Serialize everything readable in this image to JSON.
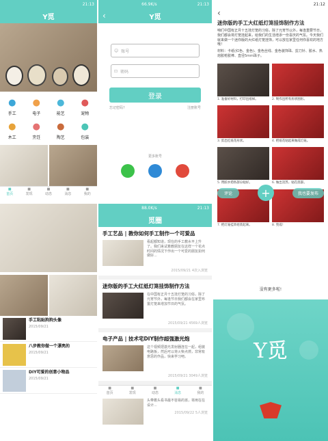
{
  "status": {
    "carrier": "",
    "time1": "21:13",
    "time2": "21:13",
    "time3": "21:12",
    "time4": "21:13",
    "speed1": "",
    "speed2": "66.9K/s",
    "speed3": "88.0K/s"
  },
  "app": {
    "title": "Y觅"
  },
  "home": {
    "grid": [
      {
        "label": "手工",
        "icon": "scissors-icon",
        "color": "#3da7d8"
      },
      {
        "label": "电子",
        "icon": "bulb-icon",
        "color": "#f0a14a"
      },
      {
        "label": "能艺",
        "icon": "paper-plane-icon",
        "color": "#4cb7d9"
      },
      {
        "label": "宠物",
        "icon": "paw-icon",
        "color": "#e05a5a"
      },
      {
        "label": "木工",
        "icon": "hammer-icon",
        "color": "#e7a33a"
      },
      {
        "label": "烹饪",
        "icon": "pot-icon",
        "color": "#e57373"
      },
      {
        "label": "陶艺",
        "icon": "vase-icon",
        "color": "#c96b3c"
      },
      {
        "label": "包装",
        "icon": "gift-icon",
        "color": "#4cc5b6"
      }
    ],
    "nav": [
      "首页",
      "发现",
      "动态",
      "消息",
      "我的"
    ]
  },
  "login": {
    "back": "‹",
    "title": "Y觅",
    "phone_placeholder": "账号",
    "password_placeholder": "密码",
    "login_button": "登录",
    "forgot": "忘记密码?",
    "register": "注册账号",
    "more": "更多账号",
    "social": [
      {
        "name": "wechat-icon",
        "color": "#3cc24a"
      },
      {
        "name": "qq-icon",
        "color": "#2f8ad6"
      },
      {
        "name": "weibo-icon",
        "color": "#e14a3c"
      }
    ]
  },
  "circle": {
    "title": "觅圈",
    "articles": [
      {
        "title": "手工艺品 | 教你如何手工制作一个可爱品",
        "text": "看起都知道，现在的手工教水平上升了。我们来试着教朋友在这样一个花点时间的情况下作出一个可爱的朋友如何做好...",
        "meta": "2015/09/21 4次入浏览"
      },
      {
        "title": "迷你版的手工大红纸灯笼挂饰制作方法",
        "text": "在中国有正月十五挂灯笼的习俗，除了元宵节外，每逢节日我们都会在家里布置灯笼来增加节日的气氛。",
        "meta": "2015/09/21 4569人浏览"
      },
      {
        "title": "电子产品 | 技术宅DIY制作超强激光炮",
        "text": "这个视频把激光发射器连在一起，组装电路板，然后可以将火柴点燃，非常有意思的作品，快来学习吧。",
        "meta": "2015/09/21 3049人浏览"
      }
    ],
    "extra": "头带着头看书最不容易的孩，将用在在设计...",
    "extra_meta": "2015/09/22 5人浏览",
    "nav": [
      "首页",
      "发现",
      "动态",
      "消息",
      "我的"
    ]
  },
  "detail": {
    "title": "迷你版的手工大红纸灯笼挂饰制作方法",
    "intro": "咱们中国有正月十五挂灯笼的习俗，除了元宵节以外，每逢重要节日，我们都会将灯笼挂起来，给我们的生活增添一份喜庆的气氛。今天我们就来做一个迷你版的大红纸灯笼挂饰，可以放在家里任何你喜欢的地方哦！",
    "materials": "材料：卡纸(红色、金色)、金色丝线、金色装饰珠、剪刀针、胶水、热熔胶枪胶棒、直径5mm珠子。",
    "steps": [
      "1. 准备好材料，打印出纸样。",
      "2. 制作出所有形状图形。",
      "3. 剪出红纸花形状。",
      "4. 把纸花粘起来做成灯笼。",
      "5. 用胶水把各部分粘好。",
      "6. 做出流苏，粘在底部。",
      "7. 把灯笼挂饰组装起来。",
      "8. 完成！"
    ],
    "comment": "评论",
    "tag": "我也要发布",
    "nomore": "没有更多啦!"
  },
  "splash": {
    "logo": "Y觅"
  }
}
